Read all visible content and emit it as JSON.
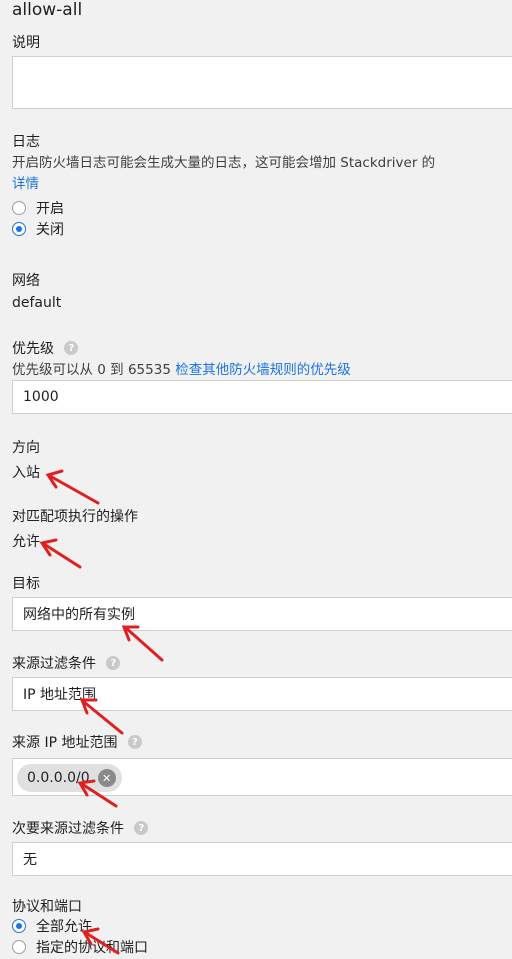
{
  "firewall_name": "allow-all",
  "description": {
    "label": "说明",
    "value": ""
  },
  "logs": {
    "label": "日志",
    "hint": "开启防火墙日志可能会生成大量的日志，这可能会增加 Stackdriver 的",
    "details_link": "详情",
    "options": [
      "开启",
      "关闭"
    ],
    "selected": "关闭"
  },
  "network": {
    "label": "网络",
    "value": "default"
  },
  "priority": {
    "label": "优先级",
    "hint": "优先级可以从 0 到 65535",
    "hint_link": "检查其他防火墙规则的优先级",
    "value": "1000"
  },
  "direction": {
    "label": "方向",
    "value": "入站"
  },
  "action": {
    "label": "对匹配项执行的操作",
    "value": "允许"
  },
  "target": {
    "label": "目标",
    "value": "网络中的所有实例"
  },
  "source_filter": {
    "label": "来源过滤条件",
    "value": "IP 地址范围"
  },
  "source_ip_ranges": {
    "label": "来源 IP 地址范围",
    "chip": "0.0.0.0/0"
  },
  "secondary_source_filter": {
    "label": "次要来源过滤条件",
    "value": "无"
  },
  "protocols_ports": {
    "label": "协议和端口",
    "options": [
      "全部允许",
      "指定的协议和端口"
    ],
    "selected": "全部允许"
  },
  "icons": {
    "help": "help-circle-icon",
    "clear": "clear-circle-icon",
    "annotation": "red-arrow-icon"
  },
  "colors": {
    "link": "#1a73e8",
    "radio_selected": "#1a73e8",
    "annotation_arrow": "#e02020"
  }
}
